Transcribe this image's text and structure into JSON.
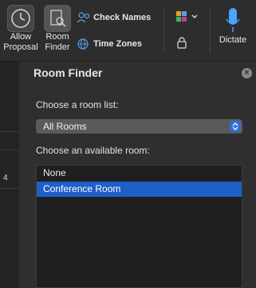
{
  "toolbar": {
    "allow_proposal": {
      "line1": "Allow",
      "line2": "Proposal",
      "icon": "clock-icon"
    },
    "room_finder": {
      "line1": "Room",
      "line2": "Finder",
      "icon": "room-finder-icon"
    },
    "check_names": {
      "label": "Check Names",
      "icon": "people-icon"
    },
    "time_zones": {
      "label": "Time Zones",
      "icon": "globe-clock-icon"
    },
    "categorize": {
      "icon": "color-grid-icon"
    },
    "private": {
      "icon": "lock-icon"
    },
    "dictate": {
      "label": "Dictate",
      "icon": "microphone-icon"
    }
  },
  "left_strip": {
    "visible_text": "4"
  },
  "panel": {
    "title": "Room Finder",
    "room_list_label": "Choose a room list:",
    "room_list_selected": "All Rooms",
    "available_room_label": "Choose an available room:",
    "rooms": [
      "None",
      "Conference Room"
    ],
    "selected_room": "Conference Room"
  },
  "colors": {
    "accent": "#1f5fc8",
    "select_bg": "#5a5a5a",
    "mic": "#4aa3ff"
  }
}
